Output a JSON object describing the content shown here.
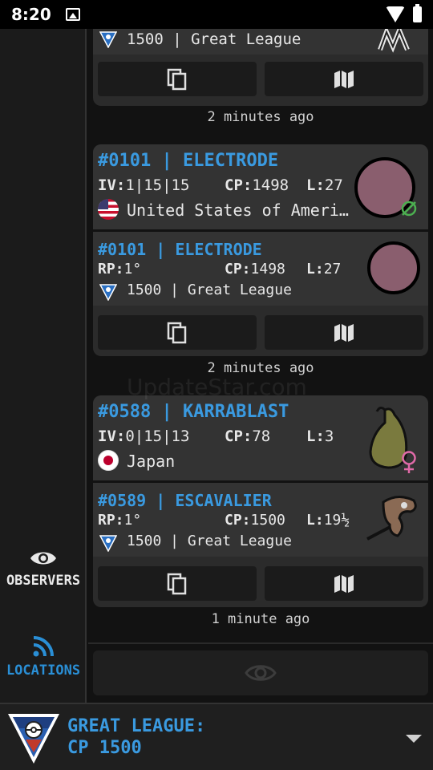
{
  "status": {
    "time": "8:20"
  },
  "rail": {
    "observers_label": "OBSERVERS",
    "locations_label": "LOCATIONS"
  },
  "colors": {
    "accent": "#3a9ae0",
    "active_rail": "#2a8fd6",
    "pokemon_ball": "#8a5e6e",
    "background": "#121212",
    "card": "#2b2b2b"
  },
  "feed": [
    {
      "partial": true,
      "pvp": {
        "league_icon": "great-league-icon",
        "league": "1500 | Great League"
      },
      "actions": {
        "copy_icon": "copy-icon",
        "map_icon": "map-icon"
      },
      "time_ago": "2 minutes ago"
    },
    {
      "spawn": {
        "title": "#0101 | ELECTRODE",
        "iv_label": "IV:",
        "iv": "1|15|15",
        "cp_label": "CP:",
        "cp": "1498",
        "lvl_label": "L:",
        "lvl": "27",
        "flag_icon": "us-flag-icon",
        "location": "United States of Ameri…",
        "gender_icon": "genderless-icon"
      },
      "pvp": {
        "title": "#0101 | ELECTRODE",
        "rp_label": "RP:",
        "rp": "1°",
        "cp_label": "CP:",
        "cp": "1498",
        "lvl_label": "L:",
        "lvl": "27",
        "league_icon": "great-league-icon",
        "league": "1500 | Great League"
      },
      "actions": {
        "copy_icon": "copy-icon",
        "map_icon": "map-icon"
      },
      "time_ago": "2 minutes ago"
    },
    {
      "spawn": {
        "title": "#0588 | KARRABLAST",
        "iv_label": "IV:",
        "iv": "0|15|13",
        "cp_label": "CP:",
        "cp": "78",
        "lvl_label": "L:",
        "lvl": "3",
        "flag_icon": "japan-flag-icon",
        "location": "Japan",
        "gender_icon": "female-icon"
      },
      "pvp": {
        "title": "#0589 | ESCAVALIER",
        "rp_label": "RP:",
        "rp": "1°",
        "cp_label": "CP:",
        "cp": "1500",
        "lvl_label": "L:",
        "lvl": "19½",
        "league_icon": "great-league-icon",
        "league": "1500 | Great League"
      },
      "actions": {
        "copy_icon": "copy-icon",
        "map_icon": "map-icon"
      },
      "time_ago": "1 minute ago"
    }
  ],
  "observer_bar": {
    "icon": "eye-icon"
  },
  "footer": {
    "line1": "GREAT LEAGUE:",
    "line2": "CP 1500",
    "icon": "great-league-icon"
  },
  "watermark": "UpdateStar.com"
}
